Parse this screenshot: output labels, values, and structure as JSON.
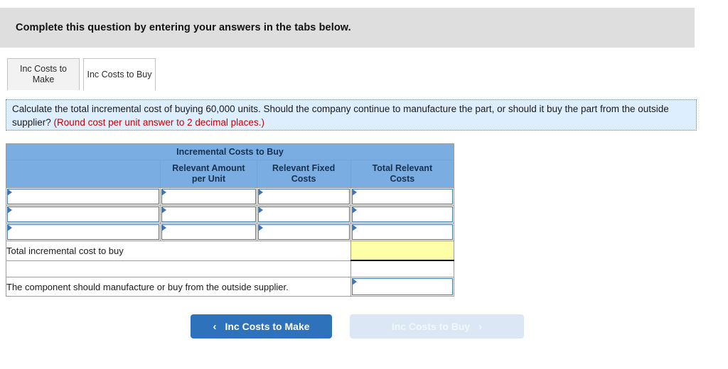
{
  "instruction": {
    "text": "Complete this question by entering your answers in the tabs below."
  },
  "tabs": [
    {
      "label": "Inc Costs to Make",
      "active": false
    },
    {
      "label": "Inc Costs to Buy",
      "active": true
    }
  ],
  "question": {
    "main": "Calculate the total incremental cost of buying 60,000 units. Should the company continue to manufacture the part, or should it buy the part from the outside supplier? ",
    "hint": "(Round cost per unit answer to 2 decimal places.)"
  },
  "table": {
    "title": "Incremental Costs to Buy",
    "column_headers": [
      "",
      "Relevant Amount per Unit",
      "Relevant Fixed Costs",
      "Total Relevant Costs"
    ],
    "column_headers_lines": [
      [
        "",
        ""
      ],
      [
        "Relevant Amount",
        "per Unit"
      ],
      [
        "Relevant Fixed",
        "Costs"
      ],
      [
        "Total Relevant",
        "Costs"
      ]
    ],
    "input_rows": [
      {
        "label": "",
        "unit": "",
        "fixed": "",
        "total": ""
      },
      {
        "label": "",
        "unit": "",
        "fixed": "",
        "total": ""
      },
      {
        "label": "",
        "unit": "",
        "fixed": "",
        "total": ""
      }
    ],
    "total_row": {
      "label": "Total incremental cost to buy",
      "value": ""
    },
    "spacer_row": {
      "label": ""
    },
    "conclusion_row": {
      "label": "The component should manufacture or buy from the outside supplier.",
      "value": ""
    }
  },
  "navigation": {
    "prev": {
      "label": "Inc Costs to Make",
      "chevron": "‹",
      "enabled": true
    },
    "next": {
      "label": "Inc Costs to Buy",
      "chevron": "›",
      "enabled": false
    }
  },
  "colors": {
    "banner_gray": "#dedede",
    "header_blue": "#7aade2",
    "question_blue": "#ddeeff",
    "hint_red": "#cc0000",
    "input_border": "#3f74b5",
    "answer_yellow": "#ffffa8",
    "button_blue": "#2f72bc",
    "button_disabled": "#dbe7f4"
  }
}
